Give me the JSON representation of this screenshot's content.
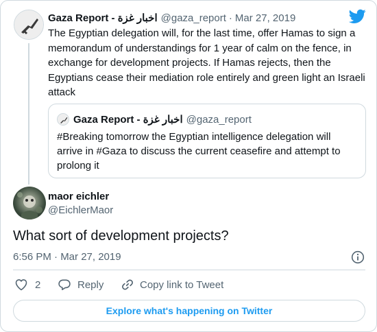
{
  "parent_tweet": {
    "author_name": "Gaza Report - اخبار غزة",
    "author_handle": "@gaza_report",
    "separator": "·",
    "date": "Mar 27, 2019",
    "text": "The Egyptian delegation will, for the last time, offer Hamas to sign a memorandum of understandings for  1 year of calm on the fence, in exchange for development projects. If Hamas rejects, then the Egyptians cease their mediation role entirely and green light an Israeli attack"
  },
  "quoted_tweet": {
    "author_name": "Gaza Report - اخبار غزة",
    "author_handle": "@gaza_report",
    "text": "#Breaking tomorrow the Egyptian intelligence delegation will arrive in #Gaza to discuss the current ceasefire and attempt to prolong it"
  },
  "reply": {
    "author_name": "maor eichler",
    "author_handle": "@EichlerMaor",
    "text": "What sort of development projects?",
    "timestamp": "6:56 PM · Mar 27, 2019"
  },
  "actions": {
    "like_count": "2",
    "reply_label": "Reply",
    "copy_link_label": "Copy link to Tweet"
  },
  "explore_label": "Explore what's happening on Twitter",
  "icons": {
    "brand": "twitter-bird-icon",
    "info": "info-icon",
    "like": "heart-icon",
    "reply": "speech-bubble-icon",
    "copy": "link-icon"
  },
  "colors": {
    "twitter_blue": "#1d9bf0",
    "secondary_text": "#536471",
    "border": "#cfd9de"
  }
}
